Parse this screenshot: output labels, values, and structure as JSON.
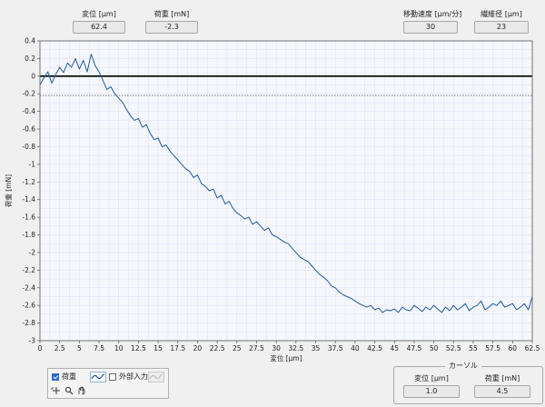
{
  "top_readouts": [
    {
      "label": "変位 [µm]",
      "value": "62.4"
    },
    {
      "label": "荷重 [mN]",
      "value": "-2.3"
    },
    {
      "label": "移動速度 [µm/分]",
      "value": "30"
    },
    {
      "label": "繊維径 [µm]",
      "value": "23"
    }
  ],
  "legend": {
    "load_label": "荷重",
    "load_checked": true,
    "external_label": "外部入力",
    "external_checked": false,
    "tool_icons": [
      "crosshair-icon",
      "zoom-icon",
      "pan-icon"
    ]
  },
  "cursor": {
    "title": "カーソル",
    "x_label": "変位 [µm]",
    "x_value": "1.0",
    "y_label": "荷重 [mN]",
    "y_value": "4.5"
  },
  "colors": {
    "trace": "#1f5a9e",
    "zero_line": "#000000",
    "grid": "#c9cff0",
    "plot_bg": "#f5f7fc"
  },
  "chart_data": {
    "type": "line",
    "xlabel": "変位 [µm]",
    "ylabel": "荷重 [mN]",
    "xlim": [
      0,
      62.5
    ],
    "ylim": [
      -3,
      0.4
    ],
    "x_ticks": [
      "0",
      "2.5",
      "5",
      "7.5",
      "10",
      "12.5",
      "15",
      "17.5",
      "20",
      "22.5",
      "25",
      "27.5",
      "30",
      "32.5",
      "35",
      "37.5",
      "40",
      "42.5",
      "45",
      "47.5",
      "50",
      "52.5",
      "55",
      "57.5",
      "60",
      "62.5"
    ],
    "y_ticks": [
      "0.4",
      "0.2",
      "0",
      "-0.2",
      "-0.4",
      "-0.6",
      "-0.8",
      "-1",
      "-1.2",
      "-1.4",
      "-1.6",
      "-1.8",
      "-2",
      "-2.2",
      "-2.4",
      "-2.6",
      "-2.8",
      "-3"
    ],
    "grid": true,
    "reference_lines": [
      {
        "y": 0,
        "style": "solid"
      },
      {
        "y": -0.22,
        "style": "dotted"
      }
    ],
    "series": [
      {
        "x": [
          0,
          0.5,
          1,
          1.5,
          2,
          2.5,
          3,
          3.5,
          4,
          4.5,
          5,
          5.5,
          6,
          6.5,
          7,
          7.5,
          8,
          8.5,
          9,
          9.5,
          10,
          10.5,
          11,
          11.5,
          12,
          12.5,
          13,
          13.5,
          14,
          14.5,
          15,
          15.5,
          16,
          16.5,
          17,
          17.5,
          18,
          18.5,
          19,
          19.5,
          20,
          20.5,
          21,
          21.5,
          22,
          22.5,
          23,
          23.5,
          24,
          24.5,
          25,
          25.5,
          26,
          26.5,
          27,
          27.5,
          28,
          28.5,
          29,
          29.5,
          30,
          30.5,
          31,
          31.5,
          32,
          32.5,
          33,
          33.5,
          34,
          34.5,
          35,
          35.5,
          36,
          36.5,
          37,
          37.5,
          38,
          38.5,
          39,
          39.5,
          40,
          40.5,
          41,
          41.5,
          42,
          42.5,
          43,
          43.5,
          44,
          44.5,
          45,
          45.5,
          46,
          46.5,
          47,
          47.5,
          48,
          48.5,
          49,
          49.5,
          50,
          50.5,
          51,
          51.5,
          52,
          52.5,
          53,
          53.5,
          54,
          54.5,
          55,
          55.5,
          56,
          56.5,
          57,
          57.5,
          58,
          58.5,
          59,
          59.5,
          60,
          60.5,
          61,
          61.5,
          62,
          62.5
        ],
        "y": [
          -0.1,
          -0.02,
          0.05,
          -0.08,
          0.02,
          0.1,
          0.04,
          0.15,
          0.1,
          0.2,
          0.08,
          0.18,
          0.05,
          0.25,
          0.12,
          0.05,
          -0.05,
          -0.15,
          -0.12,
          -0.2,
          -0.25,
          -0.3,
          -0.38,
          -0.45,
          -0.5,
          -0.48,
          -0.58,
          -0.55,
          -0.65,
          -0.72,
          -0.7,
          -0.8,
          -0.78,
          -0.85,
          -0.9,
          -0.95,
          -1.0,
          -1.05,
          -1.08,
          -1.15,
          -1.12,
          -1.22,
          -1.25,
          -1.3,
          -1.28,
          -1.38,
          -1.35,
          -1.45,
          -1.42,
          -1.5,
          -1.55,
          -1.58,
          -1.62,
          -1.6,
          -1.68,
          -1.65,
          -1.7,
          -1.75,
          -1.72,
          -1.8,
          -1.82,
          -1.85,
          -1.88,
          -1.9,
          -1.95,
          -2.0,
          -2.05,
          -2.08,
          -2.1,
          -2.15,
          -2.2,
          -2.25,
          -2.28,
          -2.32,
          -2.38,
          -2.4,
          -2.45,
          -2.48,
          -2.5,
          -2.52,
          -2.55,
          -2.58,
          -2.6,
          -2.62,
          -2.6,
          -2.65,
          -2.63,
          -2.68,
          -2.65,
          -2.66,
          -2.64,
          -2.68,
          -2.62,
          -2.65,
          -2.66,
          -2.6,
          -2.63,
          -2.67,
          -2.62,
          -2.65,
          -2.6,
          -2.64,
          -2.68,
          -2.62,
          -2.66,
          -2.6,
          -2.65,
          -2.62,
          -2.58,
          -2.66,
          -2.62,
          -2.6,
          -2.55,
          -2.65,
          -2.62,
          -2.58,
          -2.6,
          -2.55,
          -2.62,
          -2.6,
          -2.58,
          -2.65,
          -2.62,
          -2.58,
          -2.65,
          -2.5
        ]
      }
    ]
  }
}
